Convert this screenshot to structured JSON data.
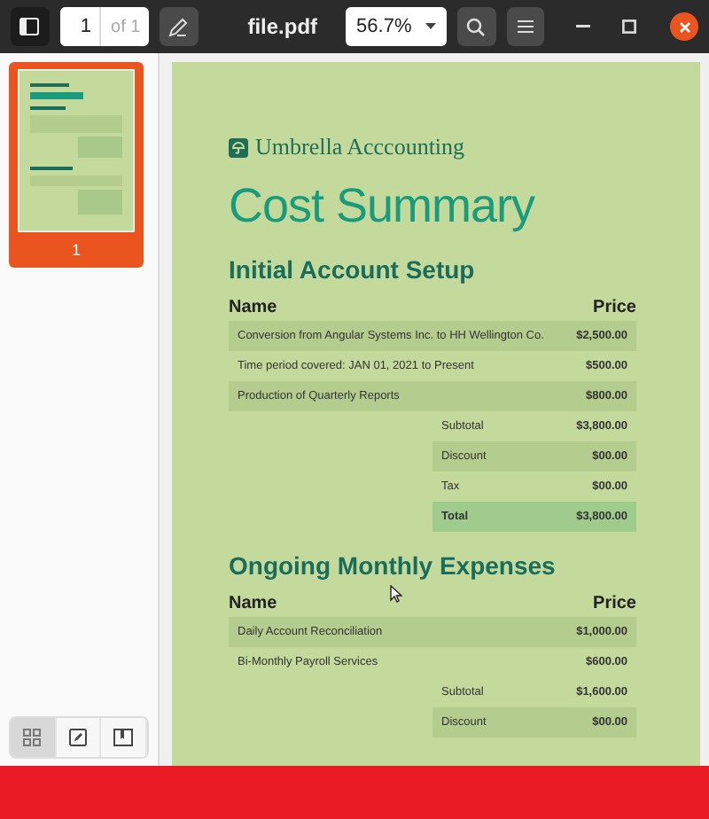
{
  "toolbar": {
    "page_value": "1",
    "page_total": "of 1",
    "title": "file.pdf",
    "zoom": "56.7%"
  },
  "sidebar": {
    "thumbnails": [
      {
        "label": "1",
        "selected": true
      }
    ],
    "view_tabs": [
      {
        "kind": "grid",
        "selected": true
      },
      {
        "kind": "annotations",
        "selected": false
      },
      {
        "kind": "bookmarks",
        "selected": false
      }
    ]
  },
  "document": {
    "brand": "Umbrella Acccounting",
    "title": "Cost Summary",
    "sections": [
      {
        "heading": "Initial Account Setup",
        "columns": [
          "Name",
          "Price"
        ],
        "rows": [
          {
            "name": "Conversion from Angular Systems Inc. to HH Wellington Co.",
            "price": "$2,500.00"
          },
          {
            "name": "Time period covered: JAN 01, 2021 to Present",
            "price": "$500.00"
          },
          {
            "name": "Production of Quarterly Reports",
            "price": "$800.00"
          }
        ],
        "totals": [
          {
            "kind": "plain",
            "label": "Subtotal",
            "value": "$3,800.00"
          },
          {
            "kind": "plain",
            "label": "Discount",
            "value": "$00.00"
          },
          {
            "kind": "plain",
            "label": "Tax",
            "value": "$00.00"
          },
          {
            "kind": "total",
            "label": "Total",
            "value": "$3,800.00"
          }
        ]
      },
      {
        "heading": "Ongoing Monthly Expenses",
        "columns": [
          "Name",
          "Price"
        ],
        "rows": [
          {
            "name": "Daily Account Reconciliation",
            "price": "$1,000.00"
          },
          {
            "name": "Bi-Monthly Payroll Services",
            "price": "$600.00"
          }
        ],
        "totals": [
          {
            "kind": "plain",
            "label": "Subtotal",
            "value": "$1,600.00"
          },
          {
            "kind": "plain",
            "label": "Discount",
            "value": "$00.00"
          }
        ]
      }
    ]
  }
}
